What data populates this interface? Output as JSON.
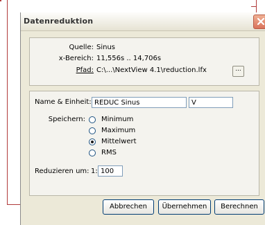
{
  "dialog": {
    "title": "Datenreduktion"
  },
  "source": {
    "quelle_label": "Quelle:",
    "quelle_value": "Sinus",
    "bereich_label": "x-Bereich:",
    "bereich_value": "11,556s .. 14,706s",
    "pfad_label": "Pfad:",
    "pfad_value": "C:\\...\\NextView 4.1\\reduction.lfx",
    "browse_label": "..."
  },
  "settings": {
    "name_label": "Name & Einheit:",
    "name_value": "REDUC Sinus",
    "unit_value": "V",
    "speichern_label": "Speichern:",
    "options": [
      {
        "label": "Minimum",
        "checked": false
      },
      {
        "label": "Maximum",
        "checked": false
      },
      {
        "label": "Mittelwert",
        "checked": true
      },
      {
        "label": "RMS",
        "checked": false
      }
    ],
    "reduzieren_label": "Reduzieren um:",
    "reduzieren_prefix": "1:",
    "reduzieren_value": "100"
  },
  "buttons": {
    "abbrechen": "Abbrechen",
    "uebernehmen": "Übernehmen",
    "berechnen": "Berechnen"
  }
}
